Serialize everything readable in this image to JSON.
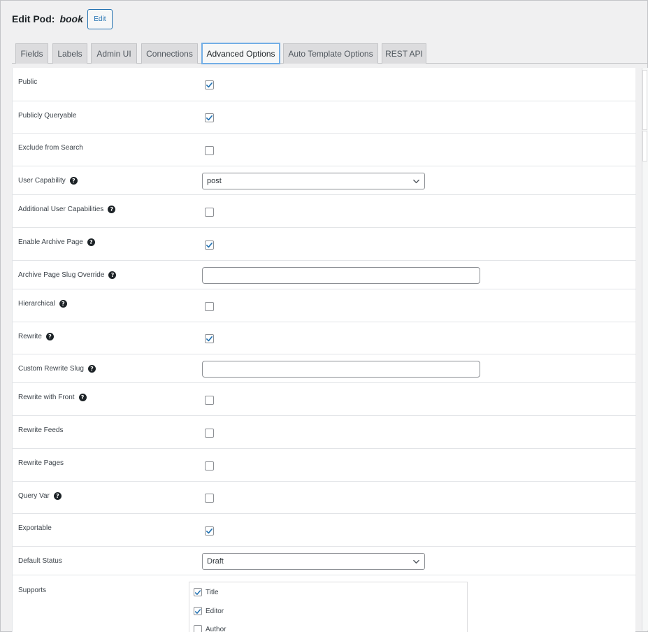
{
  "header": {
    "prefix": "Edit Pod:",
    "pod_name": "book",
    "edit_label": "Edit"
  },
  "tabs": [
    {
      "label": "Fields",
      "active": false
    },
    {
      "label": "Labels",
      "active": false
    },
    {
      "label": "Admin UI",
      "active": false
    },
    {
      "label": "Connections",
      "active": false
    },
    {
      "label": "Advanced Options",
      "active": true
    },
    {
      "label": "Auto Template Options",
      "active": false
    },
    {
      "label": "REST API",
      "active": false
    }
  ],
  "options": [
    {
      "label": "Public",
      "type": "checkbox",
      "checked": true,
      "help": false
    },
    {
      "label": "Publicly Queryable",
      "type": "checkbox",
      "checked": true,
      "help": false
    },
    {
      "label": "Exclude from Search",
      "type": "checkbox",
      "checked": false,
      "help": false
    },
    {
      "label": "User Capability",
      "type": "select",
      "value": "post",
      "help": true
    },
    {
      "label": "Additional User Capabilities",
      "type": "checkbox",
      "checked": false,
      "help": true
    },
    {
      "label": "Enable Archive Page",
      "type": "checkbox",
      "checked": true,
      "help": true
    },
    {
      "label": "Archive Page Slug Override",
      "type": "text",
      "value": "",
      "help": true
    },
    {
      "label": "Hierarchical",
      "type": "checkbox",
      "checked": false,
      "help": true
    },
    {
      "label": "Rewrite",
      "type": "checkbox",
      "checked": true,
      "help": true
    },
    {
      "label": "Custom Rewrite Slug",
      "type": "text",
      "value": "",
      "help": true
    },
    {
      "label": "Rewrite with Front",
      "type": "checkbox",
      "checked": false,
      "help": true
    },
    {
      "label": "Rewrite Feeds",
      "type": "checkbox",
      "checked": false,
      "help": false
    },
    {
      "label": "Rewrite Pages",
      "type": "checkbox",
      "checked": false,
      "help": false
    },
    {
      "label": "Query Var",
      "type": "checkbox",
      "checked": false,
      "help": true
    },
    {
      "label": "Exportable",
      "type": "checkbox",
      "checked": true,
      "help": false
    },
    {
      "label": "Default Status",
      "type": "select",
      "value": "Draft",
      "help": false
    },
    {
      "label": "Supports",
      "type": "checklist",
      "help": false
    }
  ],
  "supports": [
    {
      "label": "Title",
      "checked": true
    },
    {
      "label": "Editor",
      "checked": true
    },
    {
      "label": "Author",
      "checked": false
    }
  ],
  "colors": {
    "accent": "#2271b1",
    "active_tab_border": "#72aee6",
    "text": "#1d2327"
  },
  "icons": {
    "help": "question-circle-icon",
    "check": "checkmark-icon",
    "select_caret": "chevron-down-icon"
  }
}
